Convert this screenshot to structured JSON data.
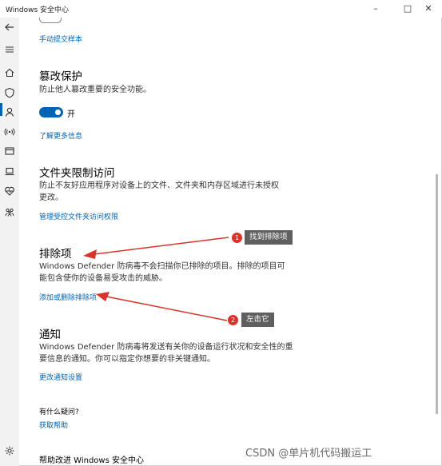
{
  "window": {
    "title": "Windows 安全中心",
    "min": "–",
    "max": "□",
    "close": "✕"
  },
  "nav": {
    "icons": [
      "back-arrow-icon",
      "hamburger-menu-icon",
      "home-icon",
      "shield-icon",
      "account-person-icon",
      "wifi-antenna-icon",
      "app-browser-icon",
      "laptop-device-icon",
      "heart-health-icon",
      "family-icon",
      "settings-gear-icon"
    ]
  },
  "sections": {
    "top_link": "手动提交样本",
    "tamper": {
      "title": "篡改保护",
      "desc": "防止他人篡改重要的安全功能。",
      "toggle_state": "开",
      "toggle_on": true,
      "link": "了解更多信息"
    },
    "folder": {
      "title": "文件夹限制访问",
      "desc": "防止不友好应用程序对设备上的文件、文件夹和内存区域进行未授权更改。",
      "link": "管理受控文件夹访问权限"
    },
    "exclusions": {
      "title": "排除项",
      "desc": "Windows Defender 防病毒不会扫描你已排除的项目。排除的项目可能包含使你的设备易受攻击的威胁。",
      "link": "添加或删除排除项"
    },
    "notify": {
      "title": "通知",
      "desc": "Windows Defender 防病毒将发送有关你的设备运行状况和安全性的重要信息的通知。你可以指定你想要的非关键通知。",
      "link": "更改通知设置"
    },
    "help": {
      "title": "有什么疑问?",
      "link": "获取帮助"
    },
    "improve": {
      "title": "帮助改进 Windows 安全中心"
    }
  },
  "annotations": {
    "callout1": {
      "num": "1",
      "text": "找到排除项"
    },
    "callout2": {
      "num": "2",
      "text": "左击它"
    },
    "arrow_color": "#d9342b"
  },
  "watermark": "CSDN @单片机代码搬运工"
}
